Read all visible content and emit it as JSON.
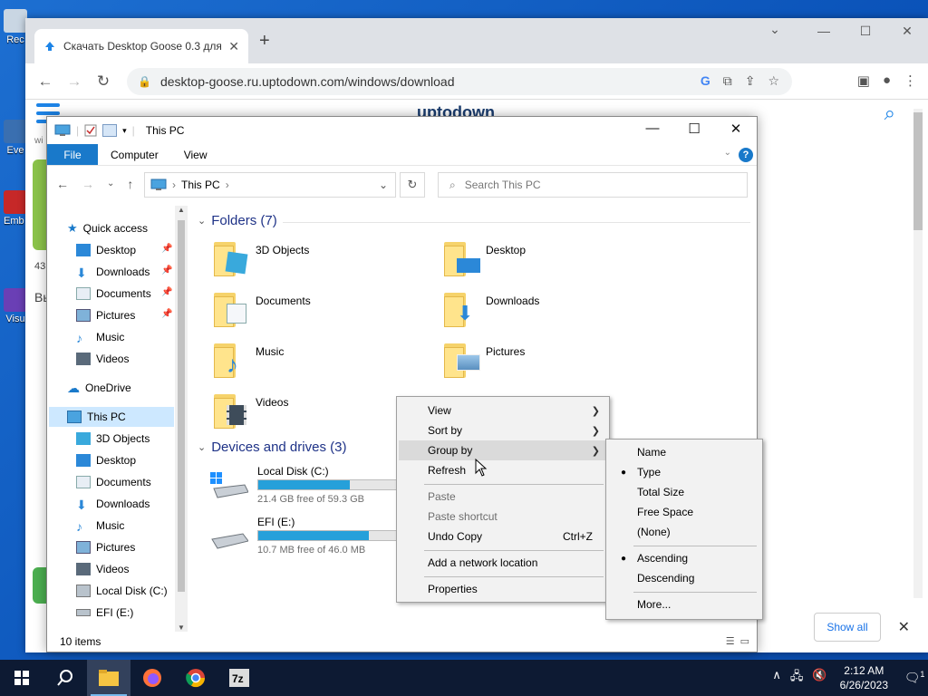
{
  "desktop": {
    "icons": [
      {
        "label": "Rec",
        "color": "#c9d6e3"
      },
      {
        "label": "Eve",
        "color": "#3a6fb0"
      },
      {
        "label": "Emb De",
        "color": "#c62828"
      },
      {
        "label": "Visu",
        "color": "#6a3fb5"
      }
    ]
  },
  "browser": {
    "tab_title": "Скачать Desktop Goose 0.3 для",
    "url": "desktop-goose.ru.uptodown.com/windows/download",
    "logo": "uptodown",
    "side_text": {
      "a": "wi",
      "b": "43",
      "c": "Вы"
    },
    "show_all": "Show all"
  },
  "explorer": {
    "title": "This PC",
    "ribbon_tabs": [
      "File",
      "Computer",
      "View"
    ],
    "address": "This PC",
    "search_placeholder": "Search This PC",
    "nav": {
      "quick_access": "Quick access",
      "qa_items": [
        "Desktop",
        "Downloads",
        "Documents",
        "Pictures",
        "Music",
        "Videos"
      ],
      "onedrive": "OneDrive",
      "this_pc": "This PC",
      "pc_items": [
        "3D Objects",
        "Desktop",
        "Documents",
        "Downloads",
        "Music",
        "Pictures",
        "Videos",
        "Local Disk (C:)",
        "EFI (E:)"
      ]
    },
    "folders_header": "Folders (7)",
    "folders": [
      "3D Objects",
      "Desktop",
      "Documents",
      "Downloads",
      "Music",
      "Pictures",
      "Videos"
    ],
    "drives_header": "Devices and drives (3)",
    "drives": [
      {
        "name": "Local Disk (C:)",
        "free": "21.4 GB free of 59.3 GB",
        "used_fraction": 0.64
      },
      {
        "name": "EFI (E:)",
        "free": "10.7 MB free of 46.0 MB",
        "used_fraction": 0.77
      }
    ],
    "status": "10 items"
  },
  "context_menu": {
    "items": {
      "view": "View",
      "sort_by": "Sort by",
      "group_by": "Group by",
      "refresh": "Refresh",
      "paste": "Paste",
      "paste_shortcut": "Paste shortcut",
      "undo_copy": "Undo Copy",
      "undo_shortcut": "Ctrl+Z",
      "add_network": "Add a network location",
      "properties": "Properties"
    }
  },
  "submenu": {
    "name": "Name",
    "type": "Type",
    "total_size": "Total Size",
    "free_space": "Free Space",
    "none": "(None)",
    "ascending": "Ascending",
    "descending": "Descending",
    "more": "More..."
  },
  "taskbar": {
    "time": "2:12 AM",
    "date": "6/26/2023",
    "notifications": "1"
  }
}
